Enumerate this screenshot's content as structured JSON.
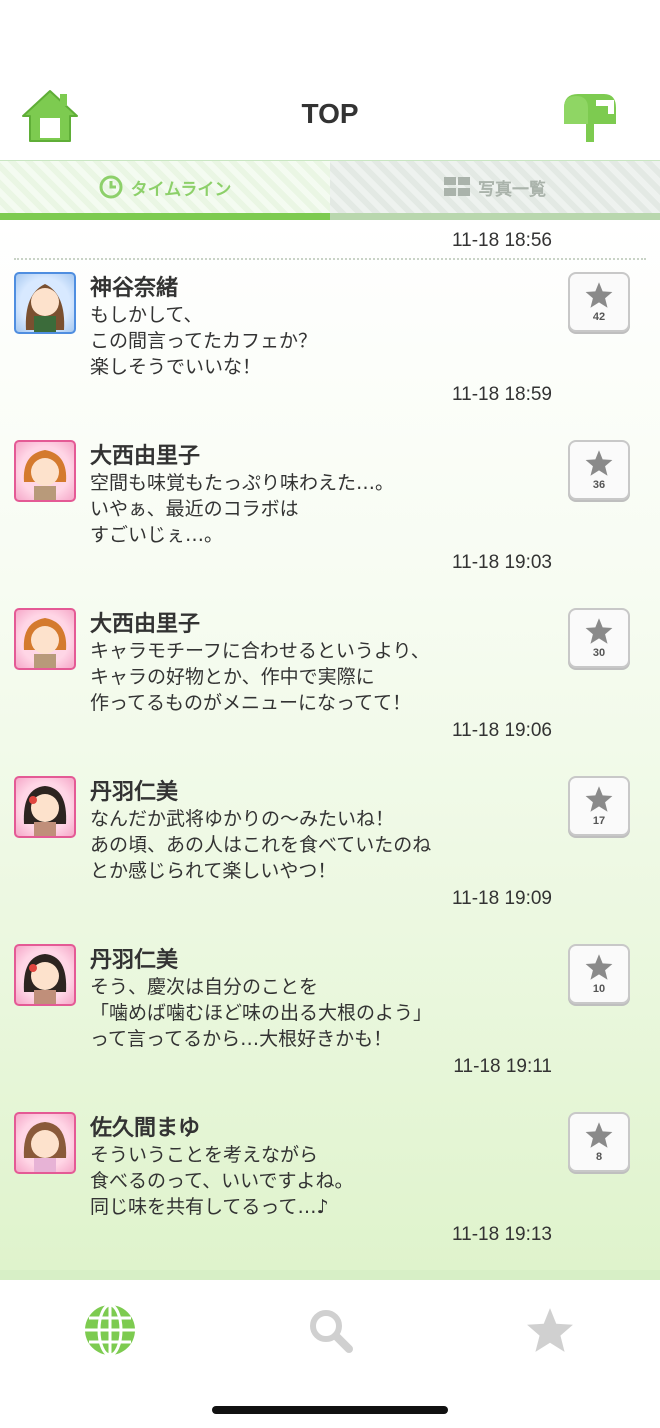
{
  "header": {
    "title": "TOP",
    "home_icon": "home-icon",
    "mail_icon": "mailbox-icon",
    "accent": "#7dcb50"
  },
  "tabs": [
    {
      "label": "タイムライン",
      "icon": "clock-icon",
      "active": true
    },
    {
      "label": "写真一覧",
      "icon": "grid-icon",
      "active": false
    }
  ],
  "feed": {
    "first_timestamp": "11-18 18:56",
    "posts": [
      {
        "name": "神谷奈緒",
        "text": "もしかして、\nこの間言ってたカフェか？\n楽しそうでいいな！",
        "time": "11-18 18:59",
        "likes": "42",
        "avatar_type": "cool"
      },
      {
        "name": "大西由里子",
        "text": "空間も味覚もたっぷり味わえた…。\nいやぁ、最近のコラボは\nすごいじぇ…。",
        "time": "11-18 19:03",
        "likes": "36",
        "avatar_type": "cute"
      },
      {
        "name": "大西由里子",
        "text": "キャラモチーフに合わせるというより、\nキャラの好物とか、作中で実際に\n作ってるものがメニューになってて！",
        "time": "11-18 19:06",
        "likes": "30",
        "avatar_type": "cute"
      },
      {
        "name": "丹羽仁美",
        "text": "なんだか武将ゆかりの〜みたいね！\nあの頃、あの人はこれを食べていたのね\nとか感じられて楽しいやつ！",
        "time": "11-18 19:09",
        "likes": "17",
        "avatar_type": "cute"
      },
      {
        "name": "丹羽仁美",
        "text": "そう、慶次は自分のことを\n「噛めば噛むほど味の出る大根のよう」\nって言ってるから…大根好きかも！",
        "time": "11-18 19:11",
        "likes": "10",
        "avatar_type": "cute"
      },
      {
        "name": "佐久間まゆ",
        "text": "そういうことを考えながら\n食べるのって、いいですよね。\n同じ味を共有してるって…♪",
        "time": "11-18 19:13",
        "likes": "8",
        "avatar_type": "cute"
      }
    ]
  },
  "bottom_nav": [
    {
      "icon": "globe-icon",
      "active": true
    },
    {
      "icon": "search-icon",
      "active": false
    },
    {
      "icon": "star-icon",
      "active": false
    }
  ]
}
